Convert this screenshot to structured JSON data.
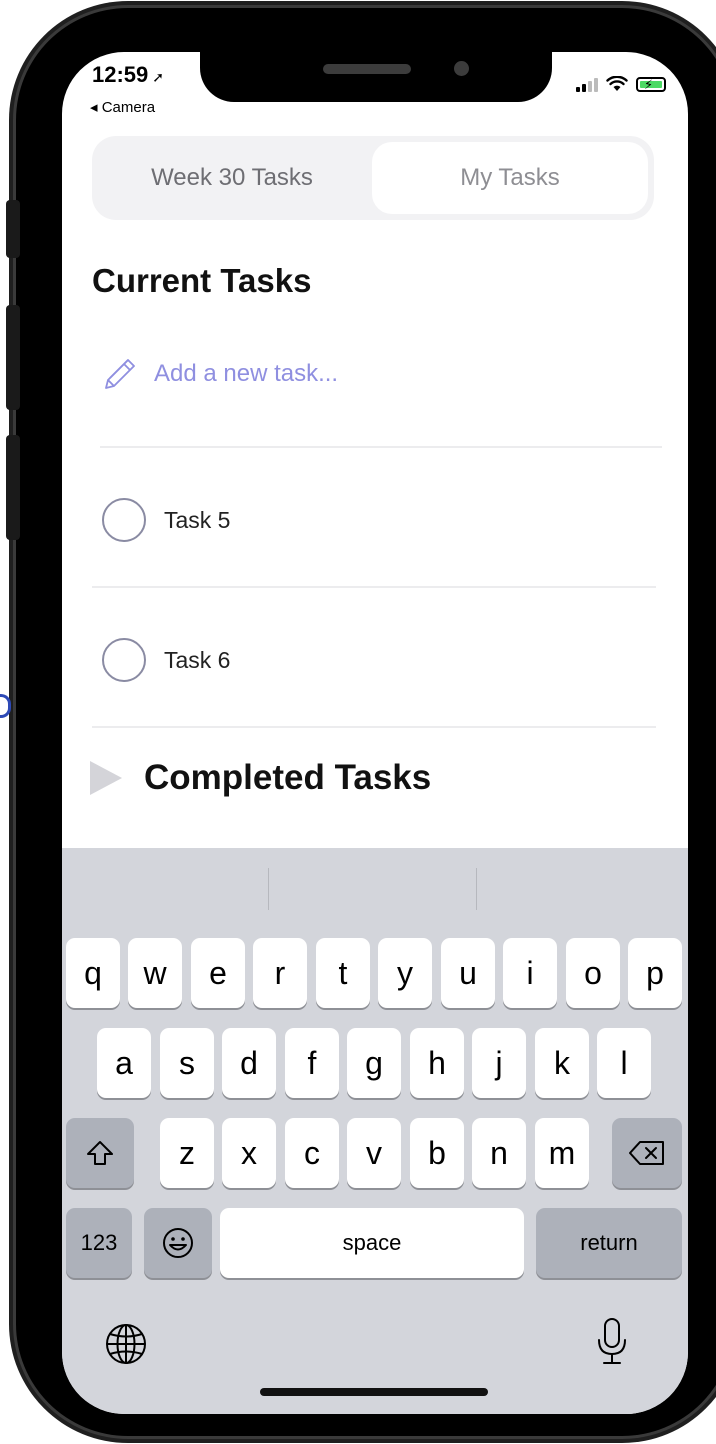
{
  "status_bar": {
    "time": "12:59",
    "location_arrow": "location-arrow-icon",
    "back_app": "◂ Camera"
  },
  "tabs": [
    {
      "label": "Week 30 Tasks",
      "selected": false
    },
    {
      "label": "My Tasks",
      "selected": true
    }
  ],
  "current_section": {
    "title": "Current Tasks",
    "add_placeholder": "Add a new task...",
    "tasks": [
      {
        "label": "Task 5"
      },
      {
        "label": "Task 6"
      }
    ]
  },
  "completed_section": {
    "title": "Completed Tasks"
  },
  "keyboard": {
    "row1": [
      "q",
      "w",
      "e",
      "r",
      "t",
      "y",
      "u",
      "i",
      "o",
      "p"
    ],
    "row2": [
      "a",
      "s",
      "d",
      "f",
      "g",
      "h",
      "j",
      "k",
      "l"
    ],
    "row3": [
      "z",
      "x",
      "c",
      "v",
      "b",
      "n",
      "m"
    ],
    "numbers_key": "123",
    "space_key": "space",
    "return_key": "return"
  },
  "colors": {
    "accent": "#8f8fe0",
    "keyboard_bg": "#d3d5db",
    "radio": "#8a8ba3"
  }
}
